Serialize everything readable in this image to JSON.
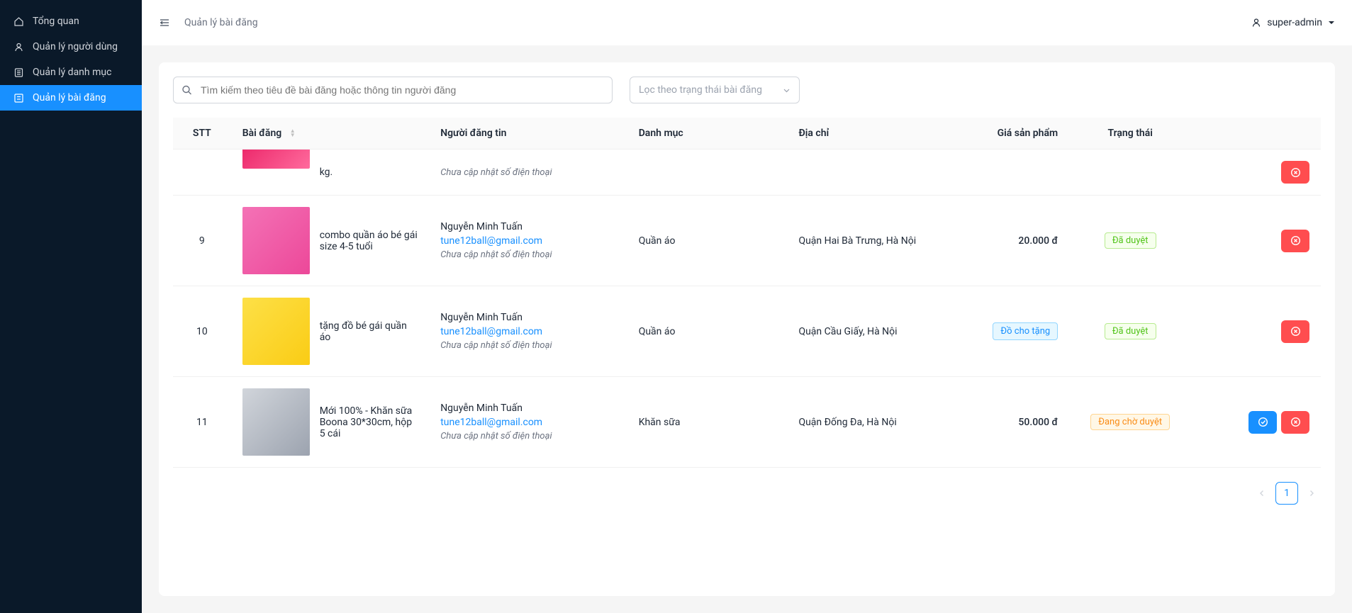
{
  "sidebar": {
    "items": [
      {
        "label": "Tổng quan",
        "icon": "home"
      },
      {
        "label": "Quản lý người dùng",
        "icon": "user"
      },
      {
        "label": "Quản lý danh mục",
        "icon": "list"
      },
      {
        "label": "Quản lý bài đăng",
        "icon": "post",
        "active": true
      }
    ]
  },
  "breadcrumb": "Quản lý bài đăng",
  "user": {
    "name": "super-admin"
  },
  "search": {
    "placeholder": "Tìm kiếm theo tiêu đề bài đăng hoặc thông tin người đăng"
  },
  "filter": {
    "placeholder": "Lọc theo trạng thái bài đăng"
  },
  "table": {
    "headers": {
      "stt": "STT",
      "post": "Bài đăng",
      "user": "Người đăng tin",
      "category": "Danh mục",
      "address": "Địa chỉ",
      "price": "Giá sản phẩm",
      "status": "Trạng thái"
    },
    "rows": [
      {
        "stt": "",
        "title": "kg.",
        "poster_name": "",
        "poster_email": "",
        "poster_phone": "Chưa cập nhật số điện thoại",
        "category": "",
        "address": "",
        "price": "",
        "price_type": "money",
        "status": "",
        "thumb_class": "t8",
        "partial": true
      },
      {
        "stt": "9",
        "title": "combo quần áo bé gái size 4-5 tuổi",
        "poster_name": "Nguyễn Minh Tuấn",
        "poster_email": "tune12ball@gmail.com",
        "poster_phone": "Chưa cập nhật số điện thoại",
        "category": "Quần áo",
        "address": "Quận Hai Bà Trưng, Hà Nội",
        "price": "20.000 đ",
        "price_type": "money",
        "status": "Đã duyệt",
        "status_class": "approved",
        "thumb_class": "t9"
      },
      {
        "stt": "10",
        "title": "tặng đồ bé gái quần áo",
        "poster_name": "Nguyễn Minh Tuấn",
        "poster_email": "tune12ball@gmail.com",
        "poster_phone": "Chưa cập nhật số điện thoại",
        "category": "Quần áo",
        "address": "Quận Cầu Giấy, Hà Nội",
        "price": "Đồ cho tặng",
        "price_type": "gift",
        "status": "Đã duyệt",
        "status_class": "approved",
        "thumb_class": "t10"
      },
      {
        "stt": "11",
        "title": "Mới 100% - Khăn sữa Boona 30*30cm, hộp 5 cái",
        "poster_name": "Nguyễn Minh Tuấn",
        "poster_email": "tune12ball@gmail.com",
        "poster_phone": "Chưa cập nhật số điện thoại",
        "category": "Khăn sữa",
        "address": "Quận Đống Đa, Hà Nội",
        "price": "50.000 đ",
        "price_type": "money",
        "status": "Đang chờ duyệt",
        "status_class": "pending",
        "thumb_class": "t11",
        "show_approve": true
      }
    ]
  },
  "pagination": {
    "current": "1"
  }
}
